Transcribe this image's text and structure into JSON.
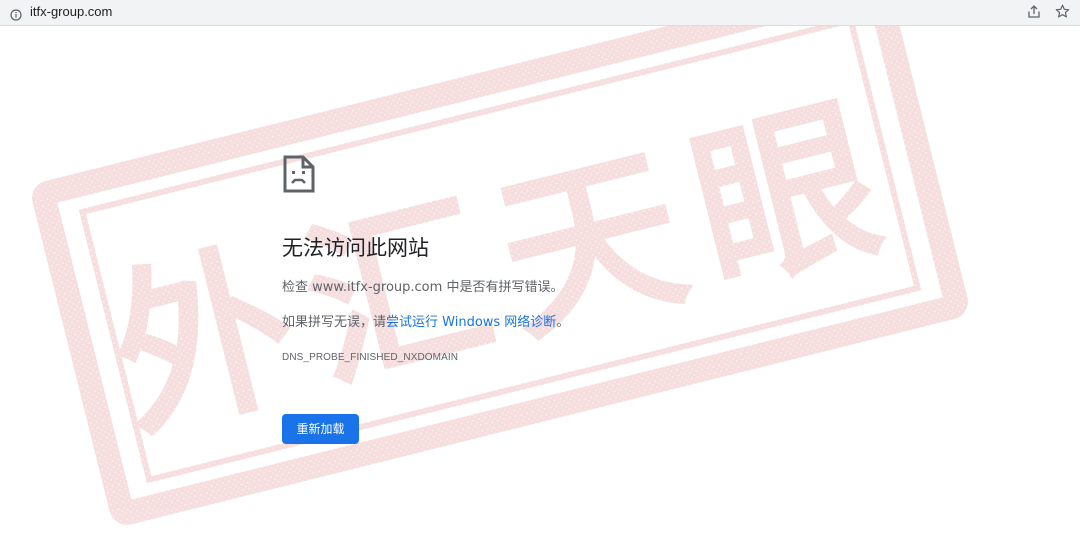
{
  "address_bar": {
    "url": "itfx-group.com",
    "info_icon": "info-icon",
    "share_icon": "share-icon",
    "bookmark_icon": "star-icon"
  },
  "error_page": {
    "icon": "sad-page-icon",
    "title": "无法访问此网站",
    "check_prefix": "检查 ",
    "domain": "www.itfx-group.com",
    "check_suffix": " 中是否有拼写错误。",
    "fix_prefix": "如果拼写无误，请",
    "fix_link": "尝试运行 Windows 网络诊断",
    "fix_suffix": "。",
    "error_code": "DNS_PROBE_FINISHED_NXDOMAIN",
    "reload_button": "重新加载"
  },
  "watermark": {
    "text": "外汇天眼",
    "color": "#c9363e"
  },
  "colors": {
    "accent": "#1a73e8",
    "text_primary": "#202124",
    "text_secondary": "#5f6368",
    "toolbar_bg": "#f1f3f4"
  }
}
